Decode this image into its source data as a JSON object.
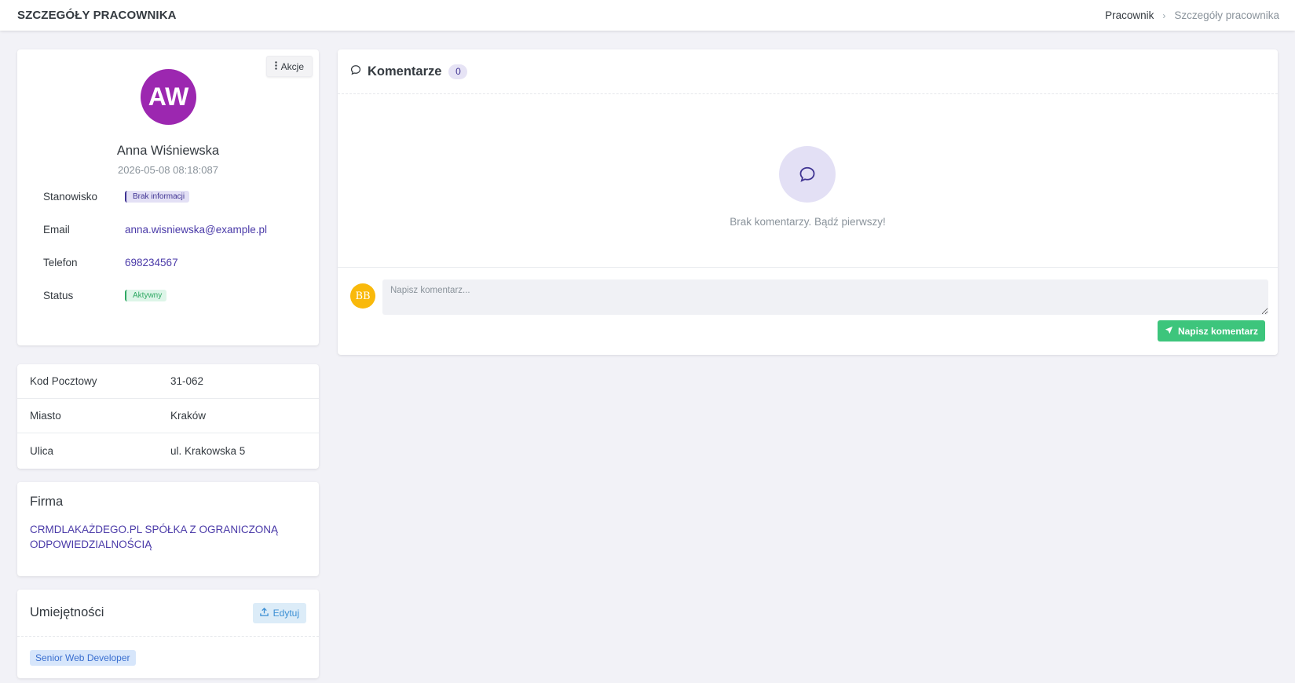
{
  "header": {
    "title": "SZCZEGÓŁY PRACOWNIKA",
    "breadcrumb": {
      "parent": "Pracownik",
      "separator": "›",
      "current": "Szczegóły pracownika"
    }
  },
  "profile": {
    "actions_label": "Akcje",
    "avatar_initials": "AW",
    "avatar_color": "#9c27b0",
    "name": "Anna Wiśniewska",
    "date": "2026-05-08 08:18:087",
    "fields": {
      "position": {
        "label": "Stanowisko",
        "value": "Brak informacji"
      },
      "email": {
        "label": "Email",
        "value": "anna.wisniewska@example.pl"
      },
      "phone": {
        "label": "Telefon",
        "value": "698234567"
      },
      "status": {
        "label": "Status",
        "value": "Aktywny"
      }
    }
  },
  "address": {
    "rows": [
      {
        "label": "Kod Pocztowy",
        "value": "31-062"
      },
      {
        "label": "Miasto",
        "value": "Kraków"
      },
      {
        "label": "Ulica",
        "value": "ul. Krakowska 5"
      }
    ]
  },
  "company": {
    "heading": "Firma",
    "name_line1": "CRMDLAKAŻDEGO.PL SPÓŁKA Z OGRANICZONĄ",
    "name_line2": "ODPOWIEDZIALNOŚCIĄ"
  },
  "skills": {
    "heading": "Umiejętności",
    "edit_label": "Edytuj",
    "items": [
      "Senior Web Developer"
    ]
  },
  "comments": {
    "title": "Komentarze",
    "count": "0",
    "empty_text": "Brak komentarzy. Bądź pierwszy!",
    "user_initials": "BB",
    "input_placeholder": "Napisz komentarz...",
    "submit_label": "Napisz komentarz"
  },
  "colors": {
    "accent": "#4a3aa8",
    "success": "#3dc57c",
    "info": "#3b8fd4",
    "user_avatar": "#f9b90b"
  }
}
